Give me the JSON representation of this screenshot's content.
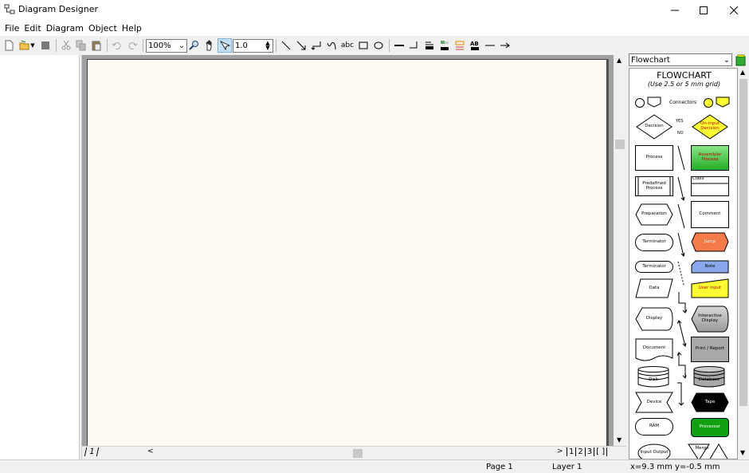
{
  "window": {
    "title": "Diagram Designer"
  },
  "menu": [
    "File",
    "Edit",
    "Diagram",
    "Object",
    "Help"
  ],
  "toolbar": {
    "zoom": "100%",
    "line_width": "1.0",
    "text_tool": "abc"
  },
  "pages": {
    "left_tab": "1",
    "tabs": [
      "1",
      "2",
      "3",
      "[ ]"
    ]
  },
  "palette": {
    "selected": "Flowchart",
    "title": "FLOWCHART",
    "subtitle": "(Use 2.5 or 5 mm grid)",
    "connectors_label": "Connectors",
    "yes": "YES",
    "no": "NO",
    "shapes": {
      "decision": "Decision",
      "oninput": "On-input Decision",
      "process": "Process",
      "assembler": "Assembler Process",
      "predefined": "Predefined Process",
      "class": "Class",
      "preparation": "Preparation",
      "comment": "Comment",
      "terminator": "Terminator",
      "jump": "Jump",
      "terminator2": "Terminator",
      "note": "Note",
      "data": "Data",
      "userinput": "User input",
      "display": "Display",
      "interactive": "Interactive Display",
      "document": "Document",
      "print": "Print / Report",
      "disk": "Disk",
      "database": "Database",
      "device": "Device",
      "tape": "Tape",
      "ram": "RAM",
      "processor": "Processor",
      "inputoutput": "Input Output",
      "merge": "Merge"
    }
  },
  "status": {
    "page": "Page 1",
    "layer": "Layer 1",
    "coords": "x=9.3 mm  y=-0.5 mm"
  },
  "colors": {
    "assembler": "#3cc43c",
    "oninput": "#ffff33",
    "jump": "#f47a48",
    "note": "#8aa8ee",
    "userinput": "#ffff33",
    "interactive": "#b0b0b0",
    "print": "#a8a8a8",
    "database": "#a8a8a8",
    "tape": "#000000",
    "processor": "#11a011"
  }
}
